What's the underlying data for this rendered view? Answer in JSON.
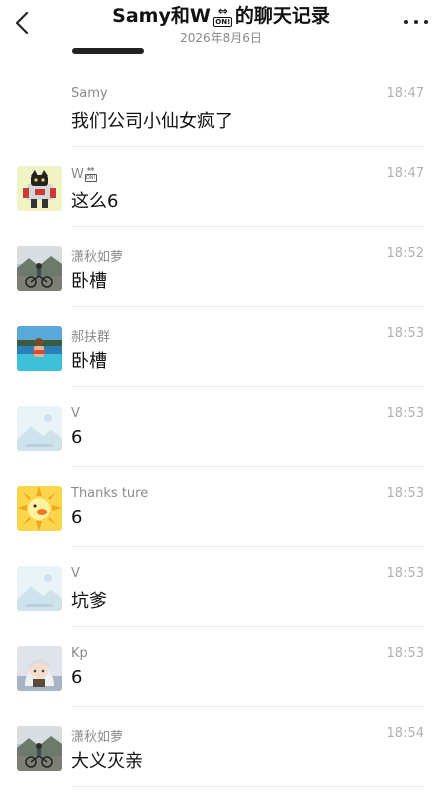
{
  "header": {
    "title_prefix": "Samy和W",
    "title_swap_arrow": "⇔",
    "title_swap_badge": "ON!",
    "title_suffix": "的聊天记录",
    "date": "2026年8月6日"
  },
  "colors": {
    "name": "#8a8a8a",
    "time": "#b0b0b0",
    "divider": "#e8e8e8"
  },
  "messages": [
    {
      "sender": "Samy",
      "time": "18:47",
      "text": "我们公司小仙女疯了",
      "avatar": "none"
    },
    {
      "sender": "W",
      "sender_swap_arrow": "⇔",
      "sender_swap_badge": "ON!",
      "time": "18:47",
      "text": "这么6",
      "avatar": "robot-cat-avatar"
    },
    {
      "sender": "潇秋如萝",
      "time": "18:52",
      "text": "卧槽",
      "avatar": "cyclist-photo-avatar"
    },
    {
      "sender": "郝扶群",
      "time": "18:53",
      "text": "卧槽",
      "avatar": "pool-photo-avatar"
    },
    {
      "sender": "V",
      "time": "18:53",
      "text": "6",
      "avatar": "placeholder-image-avatar"
    },
    {
      "sender": "Thanks ture",
      "time": "18:53",
      "text": "6",
      "avatar": "sun-duck-avatar"
    },
    {
      "sender": "V",
      "time": "18:53",
      "text": "坑爹",
      "avatar": "placeholder-image-avatar"
    },
    {
      "sender": "Kp",
      "time": "18:53",
      "text": "6",
      "avatar": "anime-girl-avatar"
    },
    {
      "sender": "潇秋如萝",
      "time": "18:54",
      "text": "大义灭亲",
      "avatar": "cyclist-photo-avatar"
    }
  ]
}
